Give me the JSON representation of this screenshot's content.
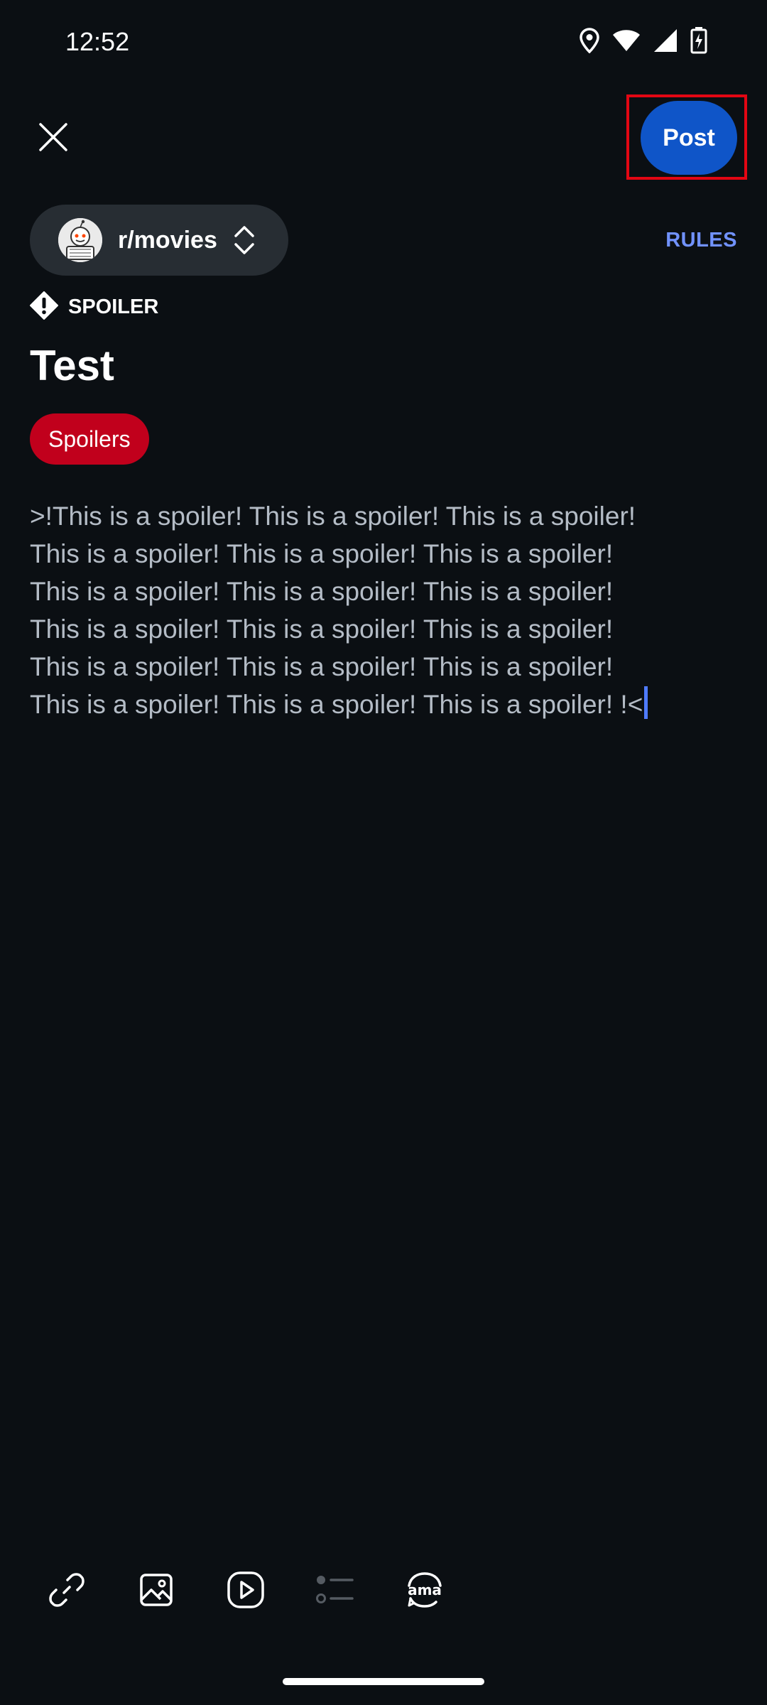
{
  "status_bar": {
    "time": "12:52",
    "icons": [
      "location-icon",
      "wifi-icon",
      "signal-icon",
      "battery-charging-icon"
    ]
  },
  "header": {
    "close_icon": "close-icon",
    "post_label": "Post"
  },
  "community": {
    "name": "r/movies",
    "rules_label": "RULES"
  },
  "post": {
    "spoiler_label": "SPOILER",
    "title": "Test",
    "flair": "Spoilers",
    "body": ">!This is a spoiler! This is a spoiler! This is a spoiler!\nThis is a spoiler! This is a spoiler! This is a spoiler!\nThis is a spoiler! This is a spoiler! This is a spoiler!\nThis is a spoiler! This is a spoiler! This is a spoiler!\nThis is a spoiler! This is a spoiler! This is a spoiler!\nThis is a spoiler! This is a spoiler! This is a spoiler! !<"
  },
  "toolbar": {
    "items": [
      "link-icon",
      "image-icon",
      "video-icon",
      "poll-icon",
      "ama-icon"
    ]
  },
  "colors": {
    "background": "#0b0f13",
    "post_button": "#0f55c8",
    "flair": "#c1001c",
    "rules": "#7192ff",
    "highlight": "#e30613"
  }
}
